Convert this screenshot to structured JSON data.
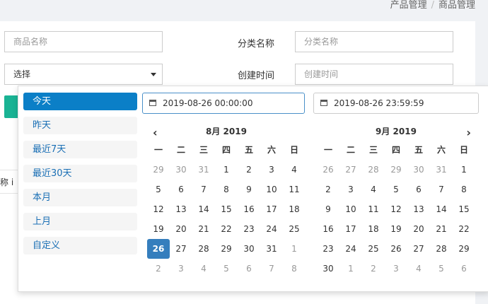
{
  "breadcrumb": [
    "产品管理",
    "商品管理"
  ],
  "filters": {
    "product_name_placeholder": "商品名称",
    "category_label": "分类名称",
    "category_placeholder": "分类名称",
    "select_value": "选择",
    "created_label": "创建时间",
    "created_placeholder": "创建时间"
  },
  "partial_table_header": "称 ⅰ",
  "ranges": [
    "今天",
    "昨天",
    "最近7天",
    "最近30天",
    "本月",
    "上月",
    "自定义"
  ],
  "active_range": "今天",
  "start_value": "2019-08-26 00:00:00",
  "end_value": "2019-08-26 23:59:59",
  "weekdays": [
    "一",
    "二",
    "三",
    "四",
    "五",
    "六",
    "日"
  ],
  "calendars": [
    {
      "title": "8月 2019",
      "days": [
        "29",
        "30",
        "31",
        "1",
        "2",
        "3",
        "4",
        "5",
        "6",
        "7",
        "8",
        "9",
        "10",
        "11",
        "12",
        "13",
        "14",
        "15",
        "16",
        "17",
        "18",
        "19",
        "20",
        "21",
        "22",
        "23",
        "24",
        "25",
        "26",
        "27",
        "28",
        "29",
        "30",
        "31",
        "1",
        "2",
        "3",
        "4",
        "5",
        "6",
        "7",
        "8"
      ],
      "off": [
        0,
        1,
        2,
        34,
        35,
        36,
        37,
        38,
        39,
        40,
        41
      ],
      "selected": 28
    },
    {
      "title": "9月 2019",
      "days": [
        "26",
        "27",
        "28",
        "29",
        "30",
        "31",
        "1",
        "2",
        "3",
        "4",
        "5",
        "6",
        "7",
        "8",
        "9",
        "10",
        "11",
        "12",
        "13",
        "14",
        "15",
        "16",
        "17",
        "18",
        "19",
        "20",
        "21",
        "22",
        "23",
        "24",
        "25",
        "26",
        "27",
        "28",
        "29",
        "30",
        "1",
        "2",
        "3",
        "4",
        "5",
        "6"
      ],
      "off": [
        0,
        1,
        2,
        3,
        4,
        5,
        36,
        37,
        38,
        39,
        40,
        41
      ],
      "selected": -1
    }
  ],
  "icons": {
    "prev": "chevron-left-icon",
    "next": "chevron-right-icon",
    "calendar": "calendar-icon"
  }
}
